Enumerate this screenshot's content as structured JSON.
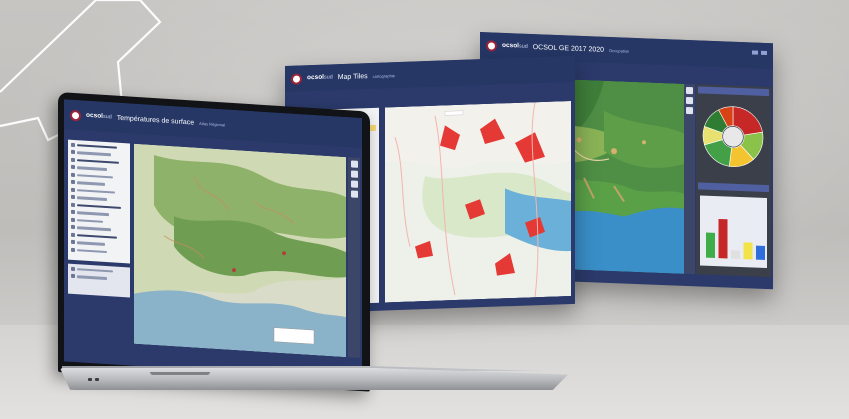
{
  "screens": {
    "laptop": {
      "brand": "ocsol",
      "brand_suffix": "sud",
      "app_title": "Températures de surface",
      "subtitle": "Atlas Régional"
    },
    "middle": {
      "brand": "ocsol",
      "brand_suffix": "sud",
      "app_title": "Map Tiles",
      "subtitle": "cartographie"
    },
    "back": {
      "brand": "ocsol",
      "brand_suffix": "sud",
      "app_title": "OCSOL GE 2017 2020",
      "subtitle": "Occupation"
    }
  },
  "colors": {
    "app_header": "#263766",
    "app_body": "#2b3a6b",
    "highlight_row": "#f7d774",
    "donut_center": "#e8e8e8"
  },
  "donut": {
    "segments": [
      {
        "color": "#c62828",
        "value": 22
      },
      {
        "color": "#8bc34a",
        "value": 16
      },
      {
        "color": "#f4c430",
        "value": 14
      },
      {
        "color": "#43a047",
        "value": 18
      },
      {
        "color": "#e8e070",
        "value": 10
      },
      {
        "color": "#2e7d32",
        "value": 12
      },
      {
        "color": "#d84315",
        "value": 8
      }
    ]
  },
  "bar_chart": {
    "series": [
      {
        "color": "#3fae49",
        "value": 45
      },
      {
        "color": "#c62828",
        "value": 70
      },
      {
        "color": "#e0e0e0",
        "value": 15
      },
      {
        "color": "#f2e34a",
        "value": 30
      },
      {
        "color": "#2f6fdc",
        "value": 25
      }
    ]
  }
}
